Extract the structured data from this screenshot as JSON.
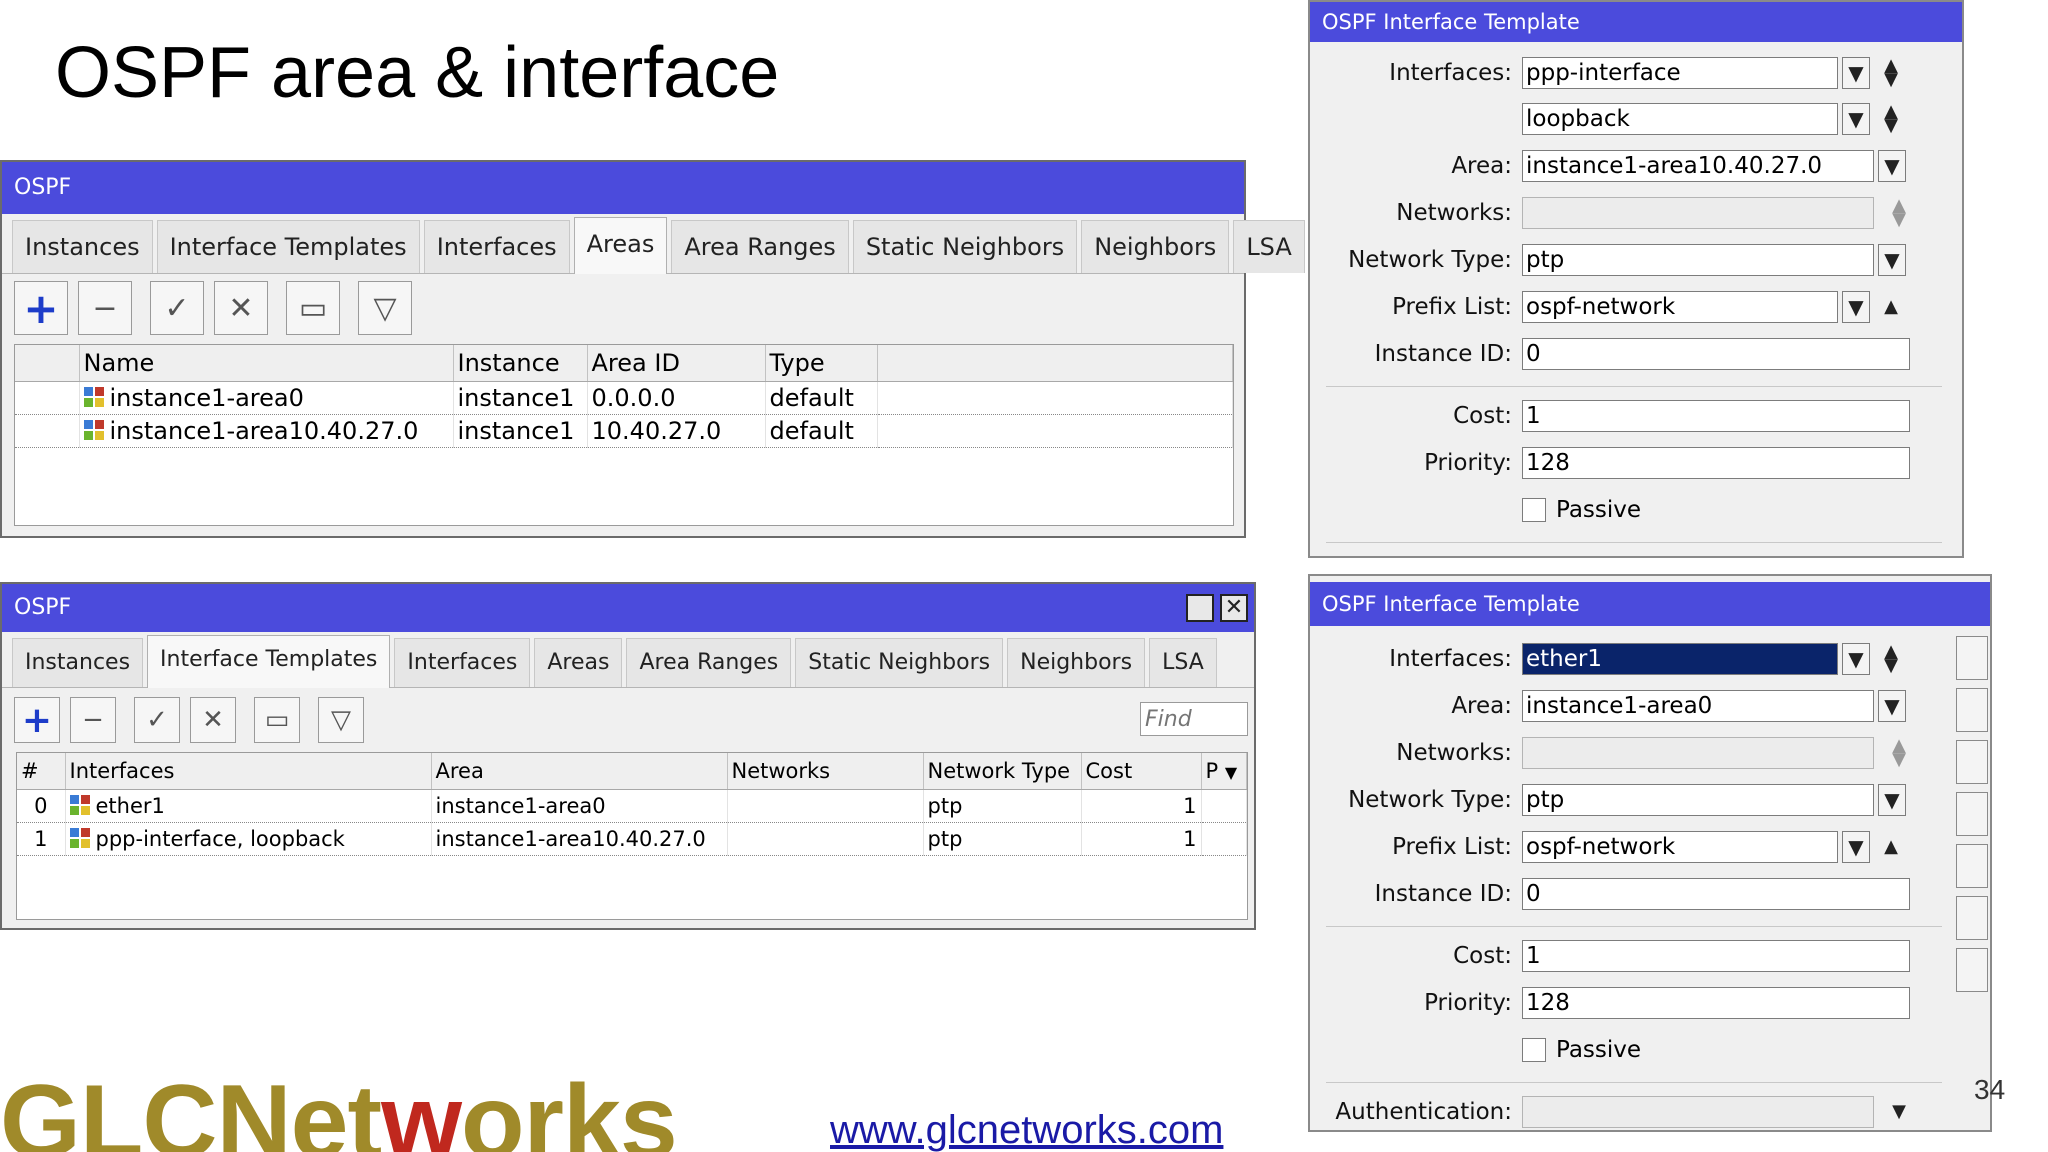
{
  "slide": {
    "title": "OSPF area & interface",
    "page_number": "34",
    "link": "www.glcnetworks.com",
    "logo": {
      "part1": "GLCNet",
      "part2": "w",
      "part3": "orks"
    }
  },
  "areas_window": {
    "title": "OSPF",
    "tabs": [
      "Instances",
      "Interface Templates",
      "Interfaces",
      "Areas",
      "Area Ranges",
      "Static Neighbors",
      "Neighbors",
      "LSA"
    ],
    "active_tab": "Areas",
    "columns": [
      "Name",
      "Instance",
      "Area ID",
      "Type"
    ],
    "rows": [
      {
        "name": "instance1-area0",
        "instance": "instance1",
        "area_id": "0.0.0.0",
        "type": "default"
      },
      {
        "name": "instance1-area10.40.27.0",
        "instance": "instance1",
        "area_id": "10.40.27.0",
        "type": "default"
      }
    ]
  },
  "templates_window": {
    "title": "OSPF",
    "tabs": [
      "Instances",
      "Interface Templates",
      "Interfaces",
      "Areas",
      "Area Ranges",
      "Static Neighbors",
      "Neighbors",
      "LSA"
    ],
    "active_tab": "Interface Templates",
    "find_placeholder": "Find",
    "columns": [
      "#",
      "Interfaces",
      "Area",
      "Networks",
      "Network Type",
      "Cost",
      "P"
    ],
    "rows": [
      {
        "num": "0",
        "interfaces": "ether1",
        "area": "instance1-area0",
        "networks": "",
        "network_type": "ptp",
        "cost": "1"
      },
      {
        "num": "1",
        "interfaces": "ppp-interface, loopback",
        "area": "instance1-area10.40.27.0",
        "networks": "",
        "network_type": "ptp",
        "cost": "1"
      }
    ]
  },
  "dialog1": {
    "title": "OSPF Interface Template",
    "labels": {
      "interfaces": "Interfaces:",
      "area": "Area:",
      "networks": "Networks:",
      "network_type": "Network Type:",
      "prefix_list": "Prefix List:",
      "instance_id": "Instance ID:",
      "cost": "Cost:",
      "priority": "Priority:",
      "passive": "Passive"
    },
    "values": {
      "interface1": "ppp-interface",
      "interface2": "loopback",
      "area": "instance1-area10.40.27.0",
      "networks": "",
      "network_type": "ptp",
      "prefix_list": "ospf-network",
      "instance_id": "0",
      "cost": "1",
      "priority": "128"
    }
  },
  "dialog2": {
    "title": "OSPF Interface Template",
    "labels": {
      "interfaces": "Interfaces:",
      "area": "Area:",
      "networks": "Networks:",
      "network_type": "Network Type:",
      "prefix_list": "Prefix List:",
      "instance_id": "Instance ID:",
      "cost": "Cost:",
      "priority": "Priority:",
      "passive": "Passive",
      "authentication": "Authentication:"
    },
    "values": {
      "interface1": "ether1",
      "area": "instance1-area0",
      "networks": "",
      "network_type": "ptp",
      "prefix_list": "ospf-network",
      "instance_id": "0",
      "cost": "1",
      "priority": "128",
      "authentication": ""
    }
  },
  "colors": {
    "titlebar": "#4b4bdc",
    "window_bg": "#f0f0f0",
    "logo_gold": "#a08a2a",
    "logo_red": "#c0281e",
    "link": "#1a1aa6"
  }
}
